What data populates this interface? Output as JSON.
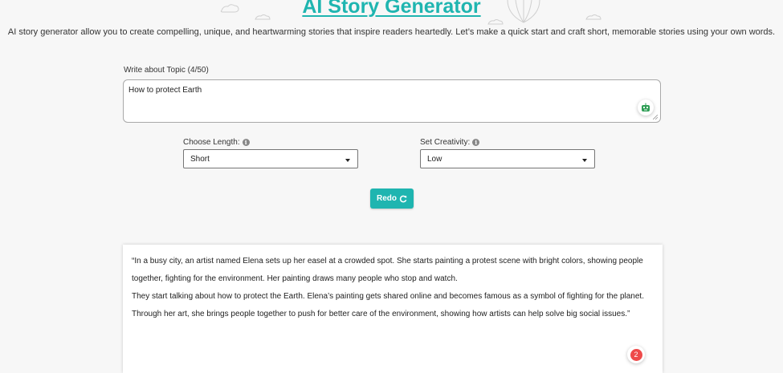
{
  "header": {
    "title": "AI Story Generator",
    "description": "AI story generator allow you to create compelling, unique, and heartwarming stories that inspire readers heartedly. Let’s make a quick start and craft short, memorable stories using your own words."
  },
  "topic": {
    "label": "Write about Topic (4/50)",
    "value": "How to protect Earth",
    "ai_icon": "robot-icon"
  },
  "length": {
    "label": "Choose Length:",
    "selected": "Short",
    "info_icon": "info-icon"
  },
  "creativity": {
    "label": "Set Creativity:",
    "selected": "Low",
    "info_icon": "info-icon"
  },
  "redo": {
    "label": "Redo",
    "icon": "refresh-icon"
  },
  "story": {
    "paragraph1": "“In a busy city, an artist named Elena sets up her easel at a crowded spot. She starts painting a protest scene with bright colors, showing people together, fighting for the environment. Her painting draws many people who stop and watch.",
    "paragraph2": "They start talking about how to protect the Earth. Elena’s painting gets shared online and becomes famous as a symbol of fighting for the planet. Through her art, she brings people together to push for better care of the environment, showing how artists can help solve big social issues.”",
    "badge_count": "2"
  },
  "colors": {
    "accent": "#1fb5b0",
    "badge": "#ee4b4b"
  }
}
